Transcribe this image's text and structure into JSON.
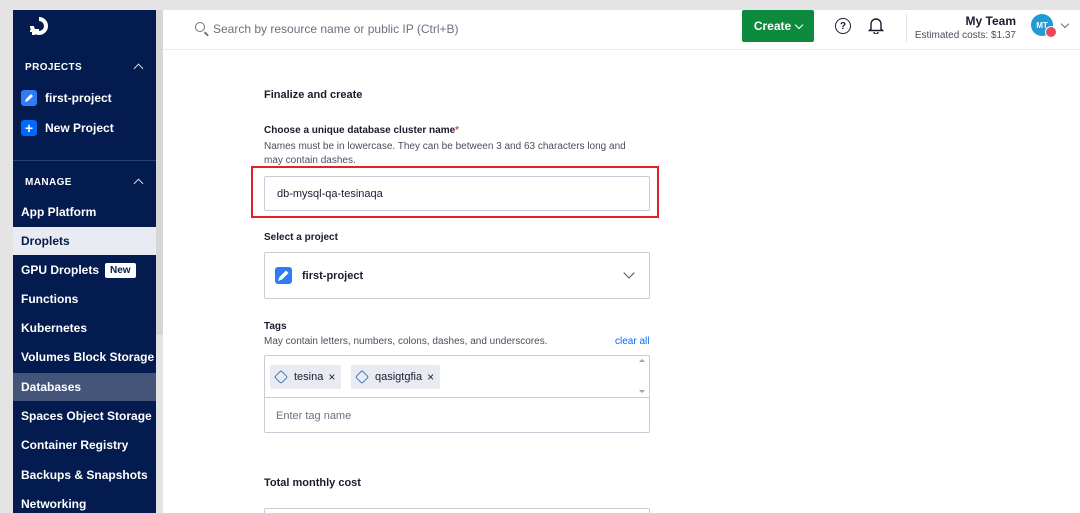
{
  "sidebar": {
    "projects_header": "PROJECTS",
    "projects": [
      {
        "label": "first-project",
        "icon": "pencil-icon"
      },
      {
        "label": "New Project",
        "icon": "plus-icon"
      }
    ],
    "manage_header": "MANAGE",
    "items": [
      {
        "label": "App Platform"
      },
      {
        "label": "Droplets"
      },
      {
        "label": "GPU Droplets",
        "badge": "New"
      },
      {
        "label": "Functions"
      },
      {
        "label": "Kubernetes"
      },
      {
        "label": "Volumes Block Storage"
      },
      {
        "label": "Databases"
      },
      {
        "label": "Spaces Object Storage"
      },
      {
        "label": "Container Registry"
      },
      {
        "label": "Backups & Snapshots"
      },
      {
        "label": "Networking"
      }
    ]
  },
  "topbar": {
    "search_placeholder": "Search by resource name or public IP (Ctrl+B)",
    "create_label": "Create",
    "help_glyph": "?",
    "team_name": "My Team",
    "estimated_costs": "Estimated costs: $1.37",
    "avatar_initials": "MT"
  },
  "form": {
    "section_title": "Finalize and create",
    "name_label": "Choose a unique database cluster name",
    "name_required": "*",
    "name_help_1": "Names must be in lowercase. They can be between 3 and 63 characters long and",
    "name_help_2": "may contain dashes.",
    "name_value": "db-mysql-qa-tesinaqa",
    "project_label": "Select a project",
    "project_value": "first-project",
    "tags_label": "Tags",
    "tags_help": "May contain letters, numbers, colons, dashes, and underscores.",
    "clear_all": "clear all",
    "tags": [
      {
        "label": "tesina",
        "remove": "×"
      },
      {
        "label": "qasigtgfia",
        "remove": "×"
      }
    ],
    "tag_placeholder": "Enter tag name",
    "total_cost_title": "Total monthly cost"
  },
  "colors": {
    "sidebar_bg": "#031b4e",
    "create_button": "#0e8a3e",
    "highlight": "#e0222b",
    "link": "#0069ff"
  }
}
